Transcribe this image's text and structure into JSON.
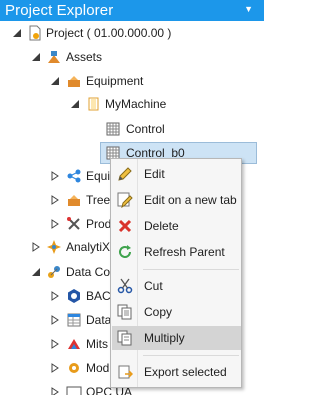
{
  "panel": {
    "title": "Project Explorer"
  },
  "tree": {
    "project": "Project ( 01.00.000.00 )",
    "assets": "Assets",
    "equipment": "Equipment",
    "machine": "MyMachine",
    "control": "Control",
    "control_b0": "Control_b0",
    "equip_partial": "Equi",
    "tree_partial": "Tree",
    "prod_partial": "Prod",
    "analytix_partial": "AnalytiX",
    "dataconn_partial": "Data Co",
    "bacnet_partial": "BACn",
    "data_partial": "Data",
    "mits_partial": "Mits",
    "mod_partial": "Mod",
    "opc_partial": "OPC UA"
  },
  "context_menu": {
    "edit": "Edit",
    "edit_new_tab": "Edit on a new tab",
    "delete": "Delete",
    "refresh_parent": "Refresh Parent",
    "cut": "Cut",
    "copy": "Copy",
    "multiply": "Multiply",
    "export_selected": "Export selected"
  },
  "colors": {
    "titlebar": "#1c97ea",
    "selection": "#cde3f5",
    "menu_hover": "#d4d4d4"
  }
}
